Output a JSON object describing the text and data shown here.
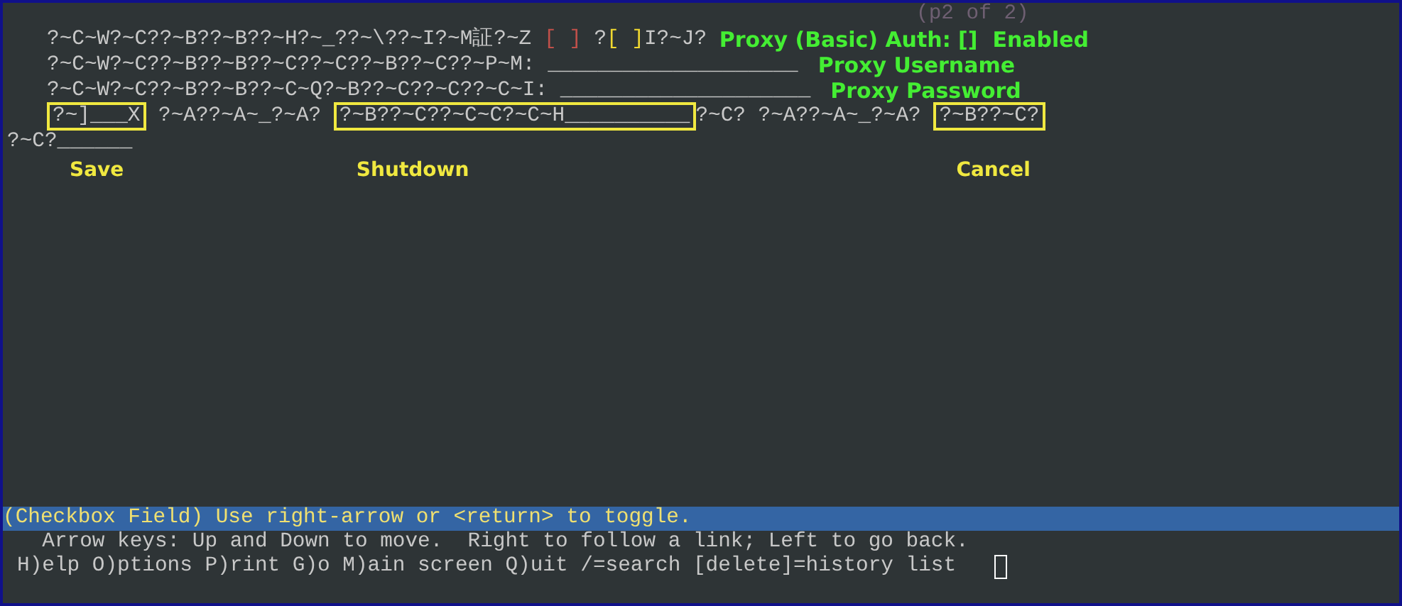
{
  "page_indicator": "(p2 of 2)",
  "rows": [
    {
      "kind": "line",
      "segments": [
        {
          "kind": "plain",
          "text": "?~C~W?~C??~B??~B??~H?~_??~\\??~I?~M証?~Z "
        },
        {
          "kind": "checkbox",
          "text": "[ ]",
          "checked": false,
          "selected": false
        },
        {
          "kind": "plain",
          "text": " ?"
        },
        {
          "kind": "checkbox",
          "text": "[ ]",
          "checked": false,
          "selected": true
        },
        {
          "kind": "plain",
          "text": "I?~J? "
        },
        {
          "kind": "note",
          "text": "Proxy (Basic) Auth: []  Enabled"
        }
      ]
    },
    {
      "kind": "line",
      "segments": [
        {
          "kind": "plain",
          "text": "?~C~W?~C??~B??~B??~C??~C??~B??~C??~P~M: "
        },
        {
          "kind": "field",
          "text": "____________________"
        },
        {
          "kind": "note",
          "text": "Proxy Username"
        }
      ]
    },
    {
      "kind": "line",
      "segments": [
        {
          "kind": "plain",
          "text": "?~C~W?~C??~B??~B??~C~Q?~B??~C??~C??~C~I: "
        },
        {
          "kind": "field",
          "text": "____________________"
        },
        {
          "kind": "note",
          "text": "Proxy Password"
        }
      ]
    },
    {
      "kind": "line",
      "segments": [
        {
          "kind": "boxed",
          "text": "?~]___X",
          "label": "Save"
        },
        {
          "kind": "plain",
          "text": " ?~A??~A~_?~A? "
        },
        {
          "kind": "boxed",
          "text": "?~B??~C??~C~C?~C~H__________",
          "label": "Shutdown"
        },
        {
          "kind": "plain",
          "text": "?~C? ?~A??~A~_?~A? "
        },
        {
          "kind": "boxed",
          "text": "?~B??~C?",
          "label": "Cancel"
        }
      ]
    },
    {
      "kind": "wrapped",
      "segments": [
        {
          "kind": "plain",
          "text": "?~C?______"
        }
      ]
    }
  ],
  "status_line": "(Checkbox Field) Use right-arrow or <return> to toggle.",
  "help_lines": [
    "  Arrow keys: Up and Down to move.  Right to follow a link; Left to go back.",
    "H)elp O)ptions P)rint G)o M)ain screen Q)uit /=search [delete]=history list"
  ]
}
